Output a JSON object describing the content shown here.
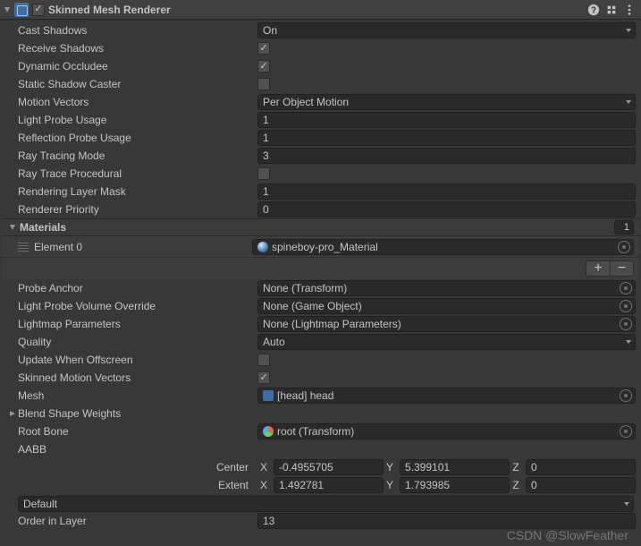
{
  "header": {
    "title": "Skinned Mesh Renderer",
    "enabled": true
  },
  "fields": {
    "castShadows": {
      "label": "Cast Shadows",
      "value": "On"
    },
    "receiveShadows": {
      "label": "Receive Shadows",
      "value": true
    },
    "dynamicOccludee": {
      "label": "Dynamic Occludee",
      "value": true
    },
    "staticShadowCaster": {
      "label": "Static Shadow Caster",
      "value": false
    },
    "motionVectors": {
      "label": "Motion Vectors",
      "value": "Per Object Motion"
    },
    "lightProbeUsage": {
      "label": "Light Probe Usage",
      "value": "1"
    },
    "reflectionProbeUsage": {
      "label": "Reflection Probe Usage",
      "value": "1"
    },
    "rayTracingMode": {
      "label": "Ray Tracing Mode",
      "value": "3"
    },
    "rayTraceProcedural": {
      "label": "Ray Trace Procedural",
      "value": false
    },
    "renderingLayerMask": {
      "label": "Rendering Layer Mask",
      "value": "1"
    },
    "rendererPriority": {
      "label": "Renderer Priority",
      "value": "0"
    },
    "probeAnchor": {
      "label": "Probe Anchor",
      "value": "None (Transform)"
    },
    "lightProbeVolumeOverride": {
      "label": "Light Probe Volume Override",
      "value": "None (Game Object)"
    },
    "lightmapParameters": {
      "label": "Lightmap Parameters",
      "value": "None (Lightmap Parameters)"
    },
    "quality": {
      "label": "Quality",
      "value": "Auto"
    },
    "updateWhenOffscreen": {
      "label": "Update When Offscreen",
      "value": false
    },
    "skinnedMotionVectors": {
      "label": "Skinned Motion Vectors",
      "value": true
    },
    "mesh": {
      "label": "Mesh",
      "value": "[head] head"
    },
    "blendShapeWeights": {
      "label": "Blend Shape Weights"
    },
    "rootBone": {
      "label": "Root Bone",
      "value": "root (Transform)"
    },
    "aabb": {
      "label": "AABB"
    },
    "centerLabel": "Center",
    "extentLabel": "Extent",
    "center": {
      "x": "-0.4955705",
      "y": "5.399101",
      "z": "0"
    },
    "extent": {
      "x": "1.492781",
      "y": "1.793985",
      "z": "0"
    },
    "sortingLayer": {
      "value": "Default"
    },
    "orderInLayer": {
      "label": "Order in Layer",
      "value": "13"
    }
  },
  "axes": {
    "x": "X",
    "y": "Y",
    "z": "Z"
  },
  "materials": {
    "title": "Materials",
    "count": "1",
    "element0Label": "Element 0",
    "element0Value": "spineboy-pro_Material"
  },
  "watermark": "CSDN @SlowFeather"
}
